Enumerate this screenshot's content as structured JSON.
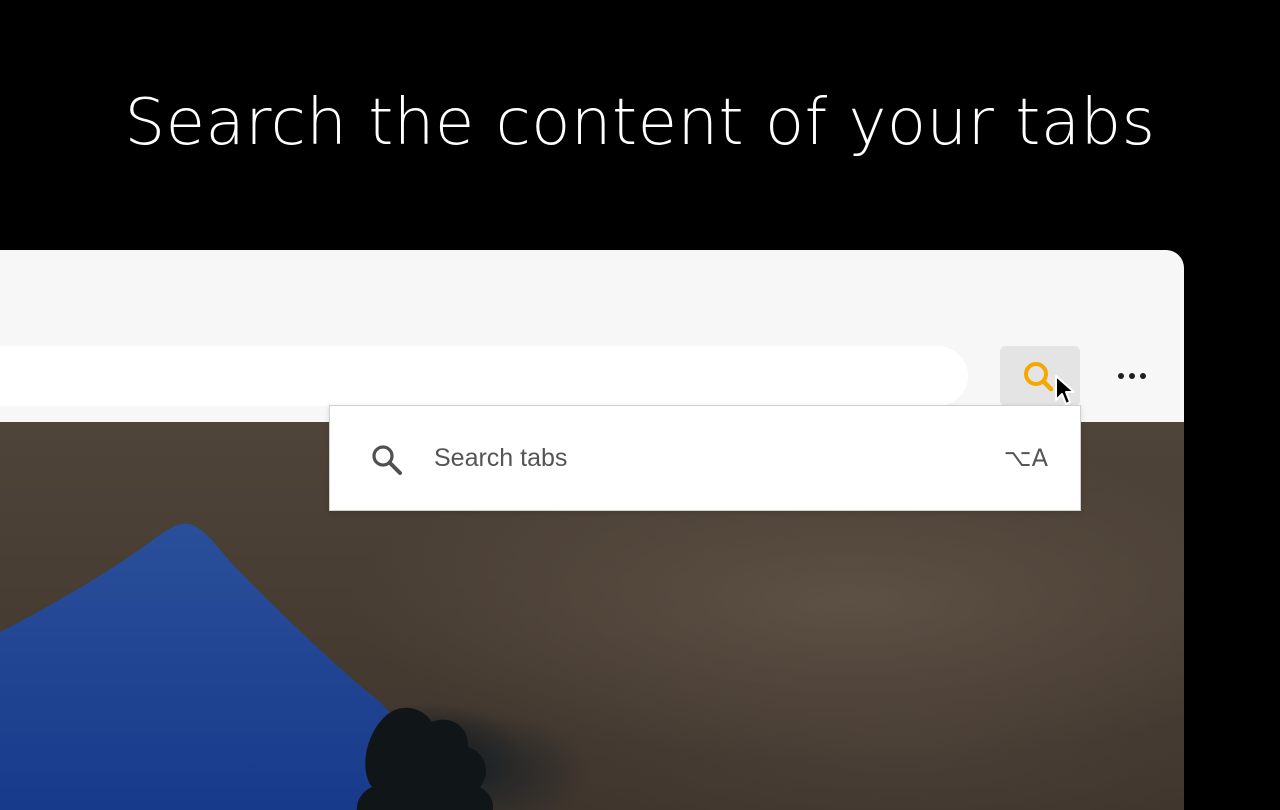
{
  "headline": "Search the content of your tabs",
  "toolbar": {
    "tab_search_icon": "magnifier-icon",
    "tab_search_icon_color": "#f5a800",
    "more_icon": "ellipsis-icon"
  },
  "dropdown": {
    "icon": "search-icon",
    "label": "Search tabs",
    "shortcut": "⌥A"
  }
}
